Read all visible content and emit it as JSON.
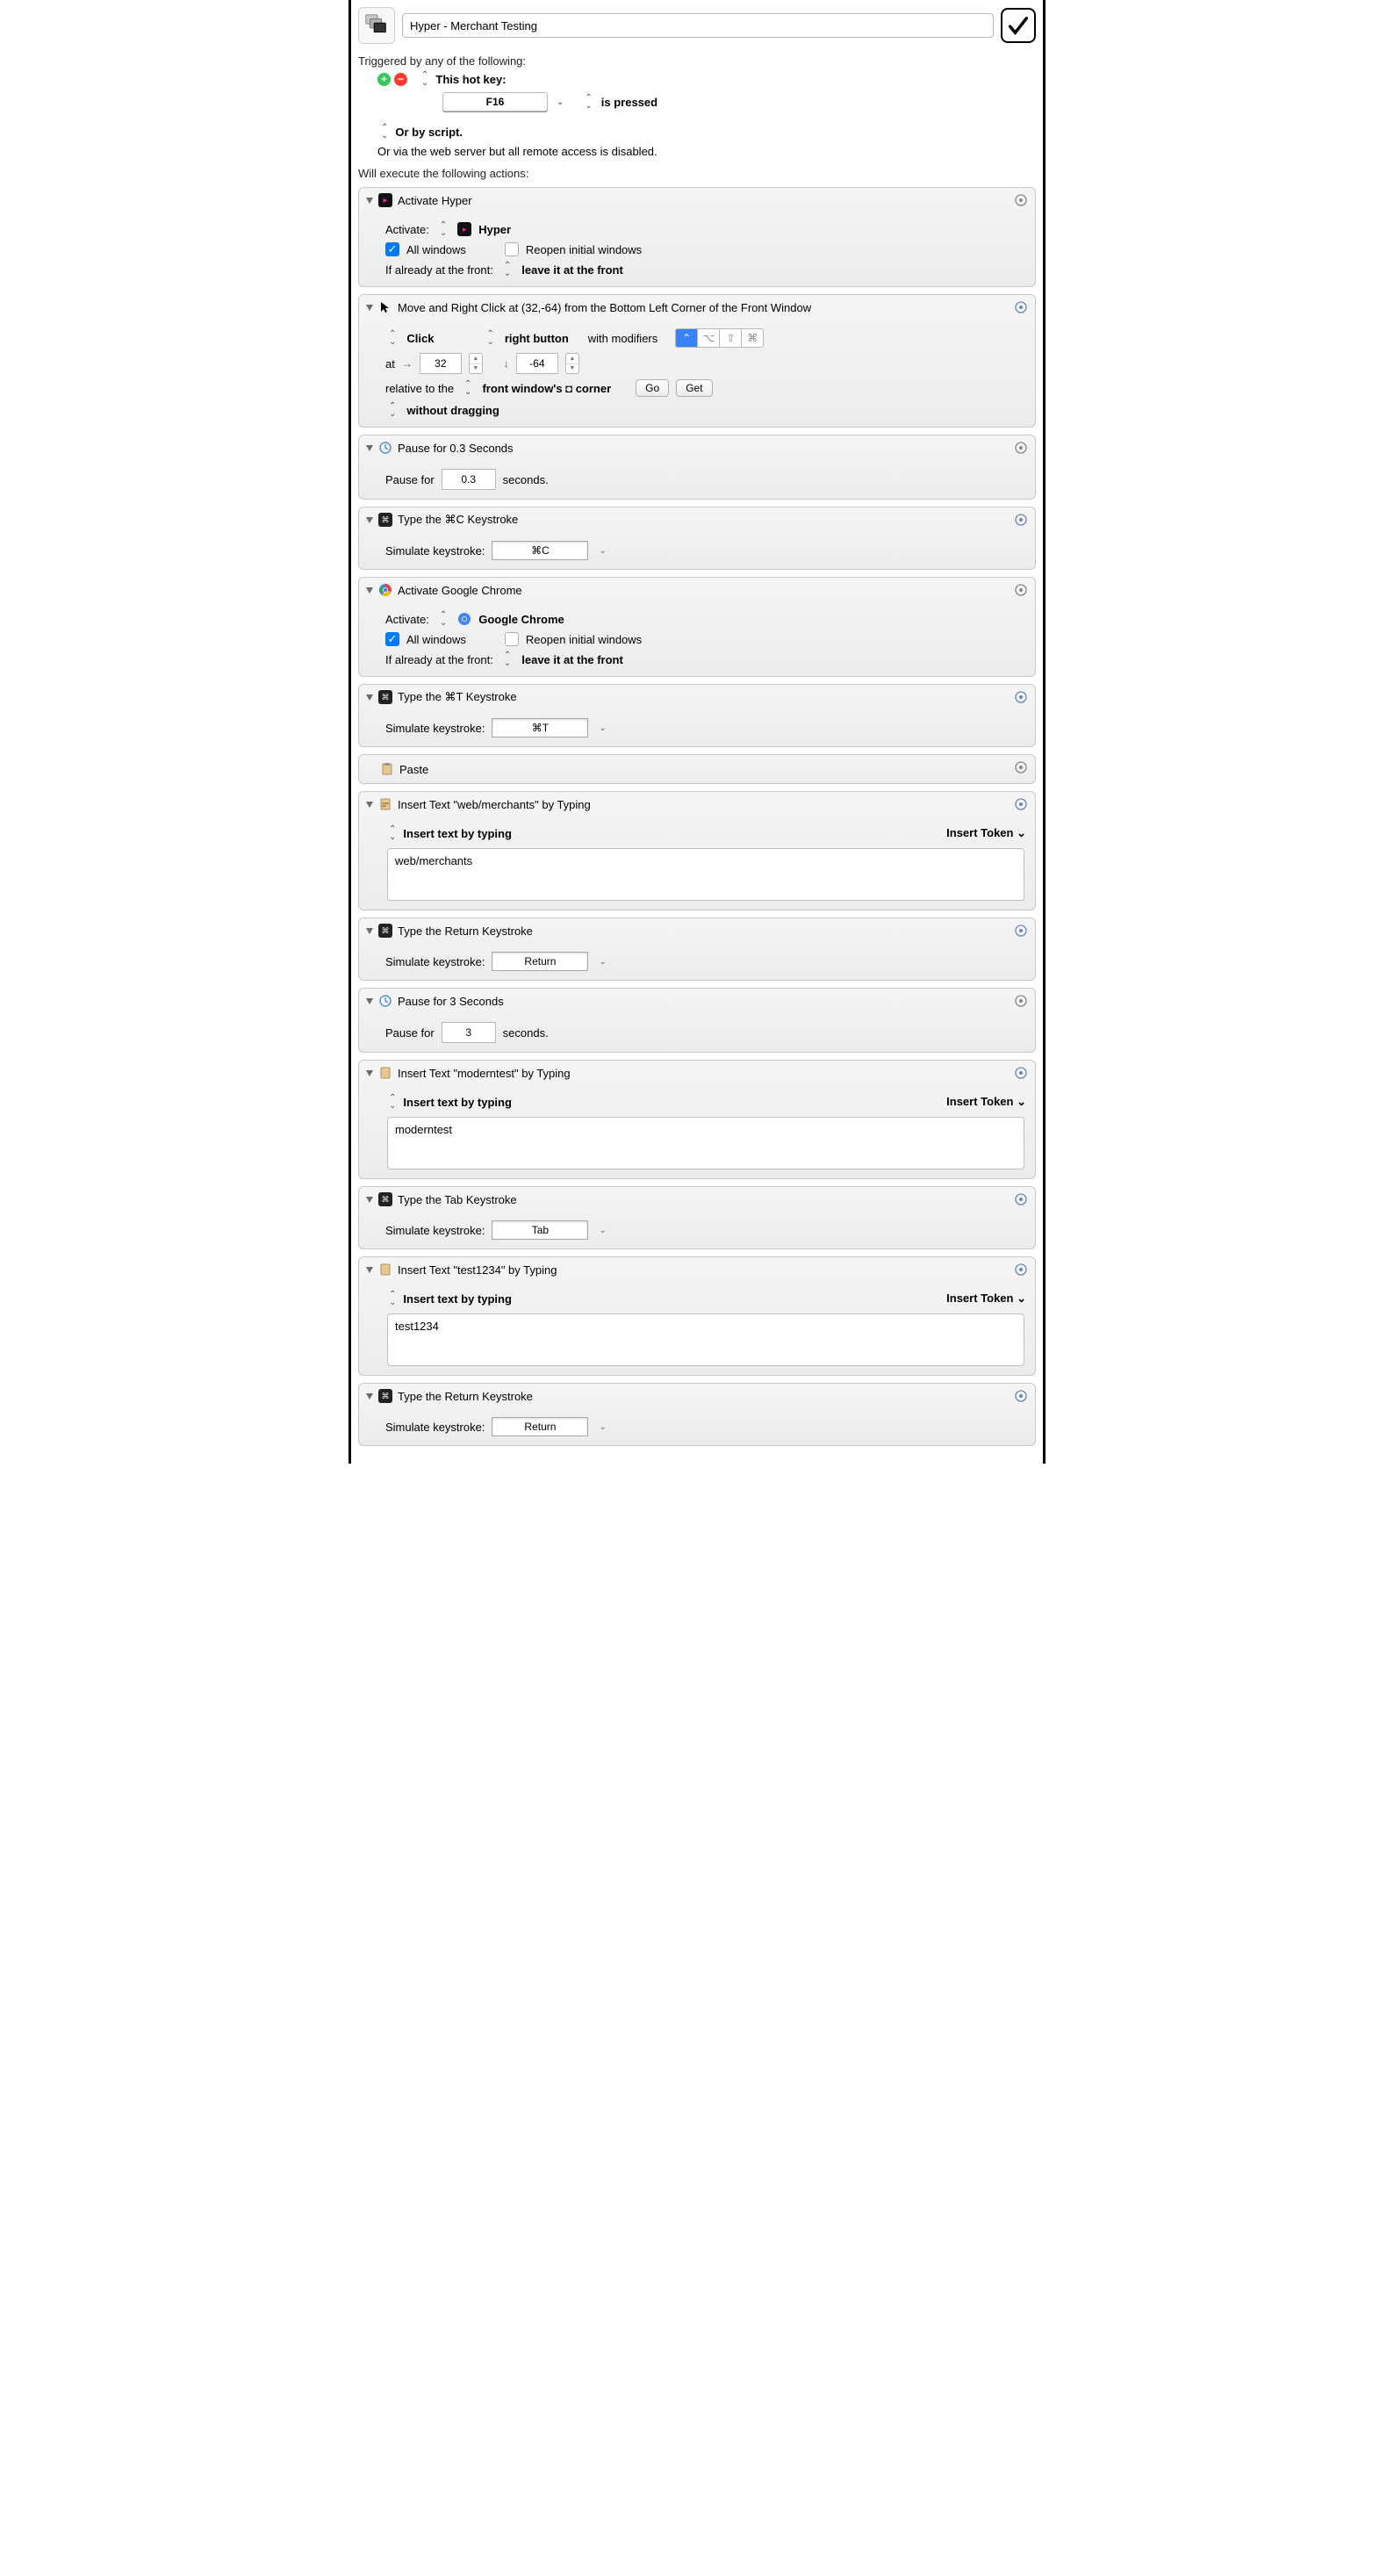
{
  "macro_title": "Hyper - Merchant Testing",
  "triggered_label": "Triggered by any of the following:",
  "hotkey_label": "This hot key:",
  "hotkey_key": "F16",
  "is_pressed_label": "is pressed",
  "or_script": "Or by script.",
  "or_web": "Or via the web server but all remote access is disabled.",
  "will_execute": "Will execute the following actions:",
  "a0": {
    "title": "Activate Hyper",
    "activate_lbl": "Activate:",
    "app": "Hyper",
    "all_windows": "All windows",
    "reopen": "Reopen initial windows",
    "front_lbl": "If already at the front:",
    "front_val": "leave it at the front"
  },
  "a1": {
    "title": "Move and Right Click at (32,-64) from the Bottom Left Corner of the Front Window",
    "click_lbl": "Click",
    "btn_lbl": "right button",
    "with_mod": "with modifiers",
    "at_lbl": "at",
    "x": "32",
    "y": "-64",
    "rel_lbl": "relative to the",
    "rel_val": "front window's ◘ corner",
    "go": "Go",
    "get": "Get",
    "drag": "without dragging"
  },
  "a2": {
    "title": "Pause for 0.3 Seconds",
    "lbl": "Pause for",
    "val": "0.3",
    "unit": "seconds."
  },
  "a3": {
    "title": "Type the ⌘C Keystroke",
    "lbl": "Simulate keystroke:",
    "val": "⌘C"
  },
  "a4": {
    "title": "Activate Google Chrome",
    "activate_lbl": "Activate:",
    "app": "Google Chrome",
    "all_windows": "All windows",
    "reopen": "Reopen initial windows",
    "front_lbl": "If already at the front:",
    "front_val": "leave it at the front"
  },
  "a5": {
    "title": "Type the ⌘T Keystroke",
    "lbl": "Simulate keystroke:",
    "val": "⌘T"
  },
  "a6": {
    "title": "Paste"
  },
  "a7": {
    "title": "Insert Text \"web/merchants\" by Typing",
    "mode": "Insert text by typing",
    "token": "Insert Token",
    "text": "web/merchants"
  },
  "a8": {
    "title": "Type the Return Keystroke",
    "lbl": "Simulate keystroke:",
    "val": "Return"
  },
  "a9": {
    "title": "Pause for 3 Seconds",
    "lbl": "Pause for",
    "val": "3",
    "unit": "seconds."
  },
  "a10": {
    "title": "Insert Text \"moderntest\" by Typing",
    "mode": "Insert text by typing",
    "token": "Insert Token",
    "text": "moderntest"
  },
  "a11": {
    "title": "Type the Tab Keystroke",
    "lbl": "Simulate keystroke:",
    "val": "Tab"
  },
  "a12": {
    "title": "Insert Text \"test1234\" by Typing",
    "mode": "Insert text by typing",
    "token": "Insert Token",
    "text": "test1234"
  },
  "a13": {
    "title": "Type the Return Keystroke",
    "lbl": "Simulate keystroke:",
    "val": "Return"
  }
}
